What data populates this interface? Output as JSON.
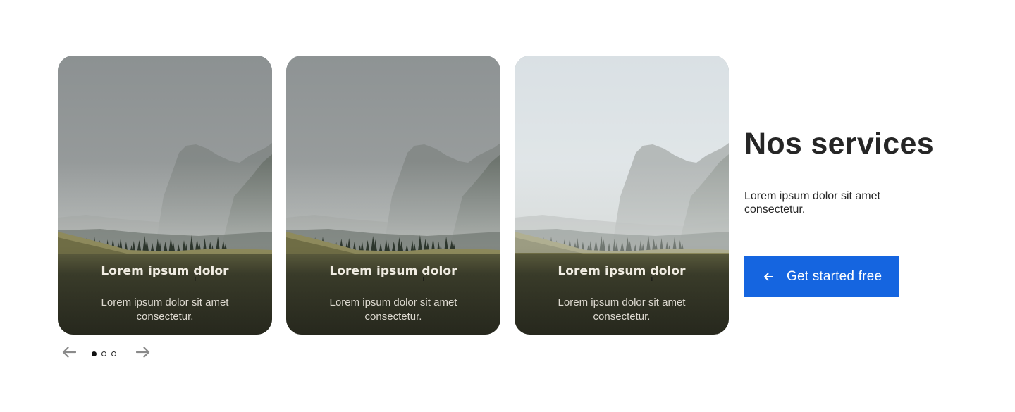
{
  "carousel": {
    "cards": [
      {
        "title": "Lorem ipsum dolor",
        "description": "Lorem ipsum dolor sit amet consectetur.",
        "sky_top": "#8c9192",
        "sky_bottom": "#a5a8a7",
        "haze": 0.0
      },
      {
        "title": "Lorem ipsum dolor",
        "description": "Lorem ipsum dolor sit amet consectetur.",
        "sky_top": "#8e9394",
        "sky_bottom": "#a7aaa9",
        "haze": 0.0
      },
      {
        "title": "Lorem ipsum dolor",
        "description": "Lorem ipsum dolor sit amet consectetur.",
        "sky_top": "#cdd6dc",
        "sky_bottom": "#e9eceb",
        "haze": 0.35
      }
    ],
    "controls": {
      "prev_icon": "arrow-left-icon",
      "next_icon": "arrow-right-icon",
      "dot_count": 3,
      "active_dot": 0
    }
  },
  "services": {
    "heading": "Nos services",
    "subtext": "Lorem ipsum dolor sit amet consectetur.",
    "cta_label": "Get started free",
    "cta_icon": "arrow-left-icon",
    "cta_color": "#1565e0"
  }
}
